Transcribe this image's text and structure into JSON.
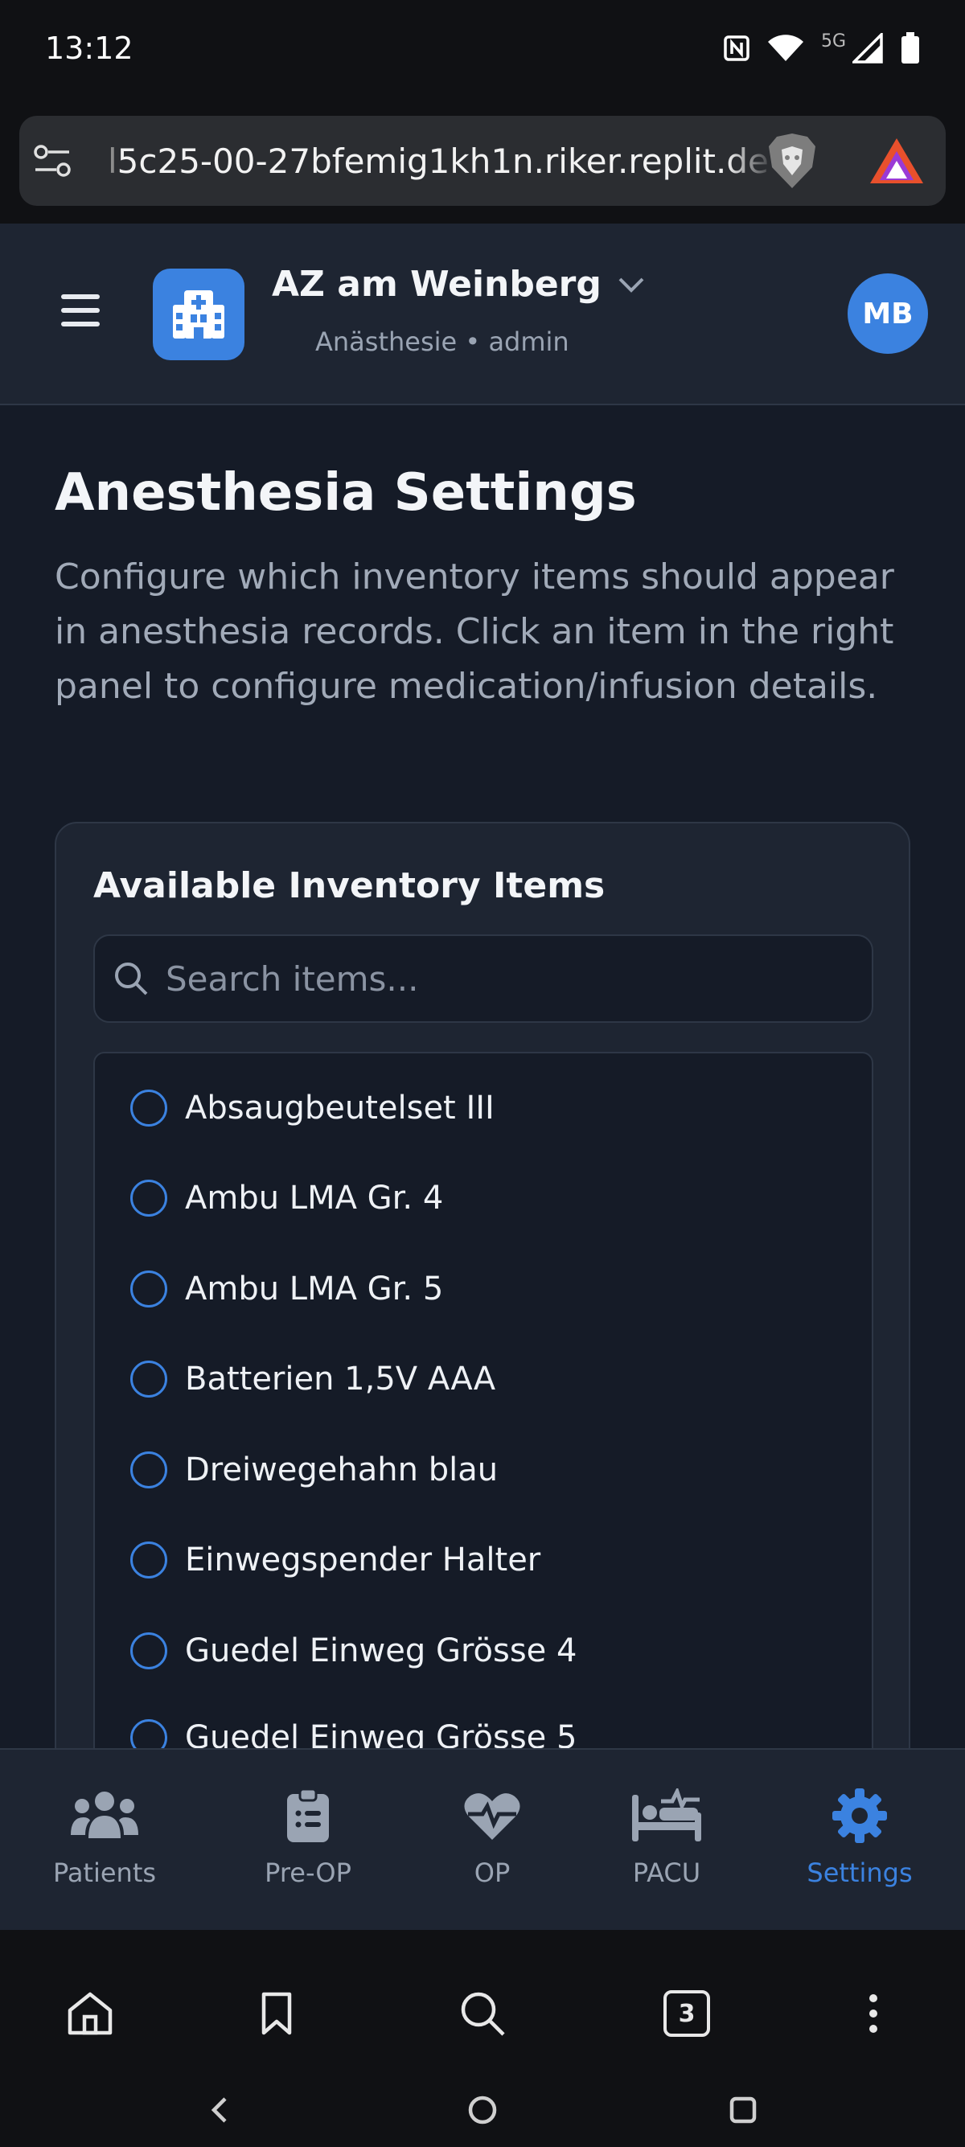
{
  "status_bar": {
    "time": "13:12",
    "network": "5G"
  },
  "browser": {
    "url_visible": "5c25-00-27bfemig1kh1n.riker.replit.dev",
    "url_prefix_dim": "l",
    "tab_count": "3"
  },
  "header": {
    "org_name": "AZ am Weinberg",
    "org_subtitle": "Anästhesie • admin",
    "avatar_initials": "MB"
  },
  "page": {
    "title": "Anesthesia Settings",
    "description": "Configure which inventory items should appear in anesthesia records. Click an item in the right panel to configure medication/infusion details."
  },
  "inventory": {
    "title": "Available Inventory Items",
    "search_placeholder": "Search items...",
    "items": [
      {
        "label": "Absaugbeutelset III"
      },
      {
        "label": "Ambu LMA Gr. 4"
      },
      {
        "label": "Ambu LMA Gr. 5"
      },
      {
        "label": "Batterien 1,5V AAA"
      },
      {
        "label": "Dreiwegehahn blau"
      },
      {
        "label": "Einwegspender Halter"
      },
      {
        "label": "Guedel Einweg Grösse 4"
      },
      {
        "label": "Guedel Einweg Grösse 5"
      }
    ]
  },
  "nav": {
    "items": [
      {
        "label": "Patients",
        "icon": "users-icon"
      },
      {
        "label": "Pre-OP",
        "icon": "clipboard-list-icon"
      },
      {
        "label": "OP",
        "icon": "heart-pulse-icon"
      },
      {
        "label": "PACU",
        "icon": "bed-pulse-icon"
      },
      {
        "label": "Settings",
        "icon": "gear-icon",
        "active": true
      }
    ]
  },
  "colors": {
    "accent": "#3b82e0",
    "background": "#151b27",
    "surface": "#1e2532"
  }
}
